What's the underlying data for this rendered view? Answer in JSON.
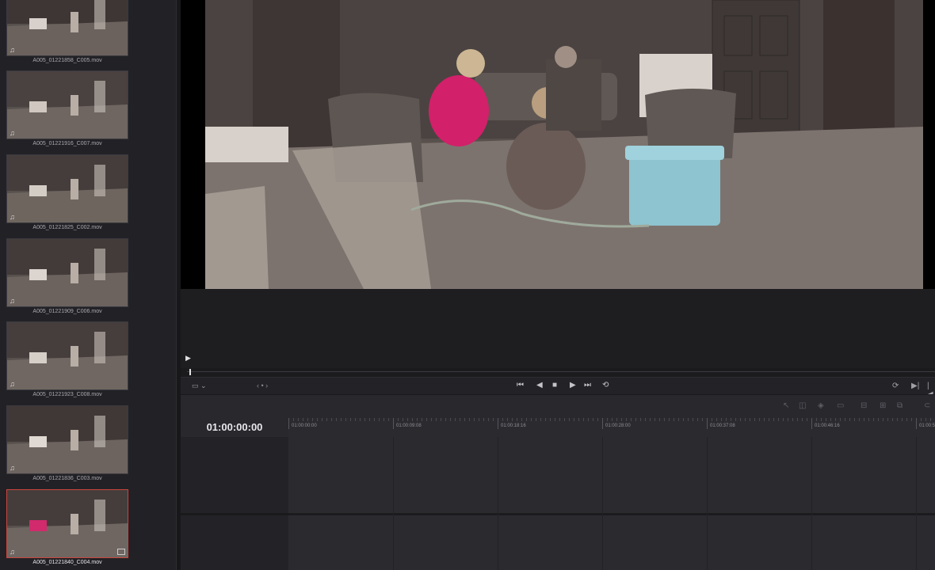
{
  "media_pool": {
    "clips": [
      {
        "name": "A005_01221858_C005.mov",
        "selected": false
      },
      {
        "name": "A005_01221916_C007.mov",
        "selected": false
      },
      {
        "name": "A005_01221825_C002.mov",
        "selected": false
      },
      {
        "name": "A005_01221909_C006.mov",
        "selected": false
      },
      {
        "name": "A005_01221923_C008.mov",
        "selected": false
      },
      {
        "name": "A005_01221836_C003.mov",
        "selected": false
      },
      {
        "name": "A005_01221840_C004.mov",
        "selected": true
      }
    ],
    "audio_icon": "music-note-icon"
  },
  "viewer": {
    "marker_icon": "play-marker-icon"
  },
  "transport": {
    "buttons": [
      {
        "name": "go-to-start-button",
        "glyph": "⏮"
      },
      {
        "name": "step-back-button",
        "glyph": "◀"
      },
      {
        "name": "stop-button",
        "glyph": "■"
      },
      {
        "name": "play-button",
        "glyph": "▶"
      },
      {
        "name": "go-to-end-button",
        "glyph": "⏭"
      },
      {
        "name": "loop-button",
        "glyph": "⟲"
      }
    ],
    "jog_glyph": "‹ • ›"
  },
  "timeline": {
    "timecode": "01:00:00:00",
    "ruler_labels": [
      "01:00:00:00",
      "01:00:09:08",
      "01:00:18:16",
      "01:00:28:00",
      "01:00:37:08",
      "01:00:46:16",
      "01:00:5"
    ]
  },
  "colors": {
    "selected_border": "#c9453f",
    "panel_bg": "#222226",
    "track_bg": "#2a2a2f"
  }
}
